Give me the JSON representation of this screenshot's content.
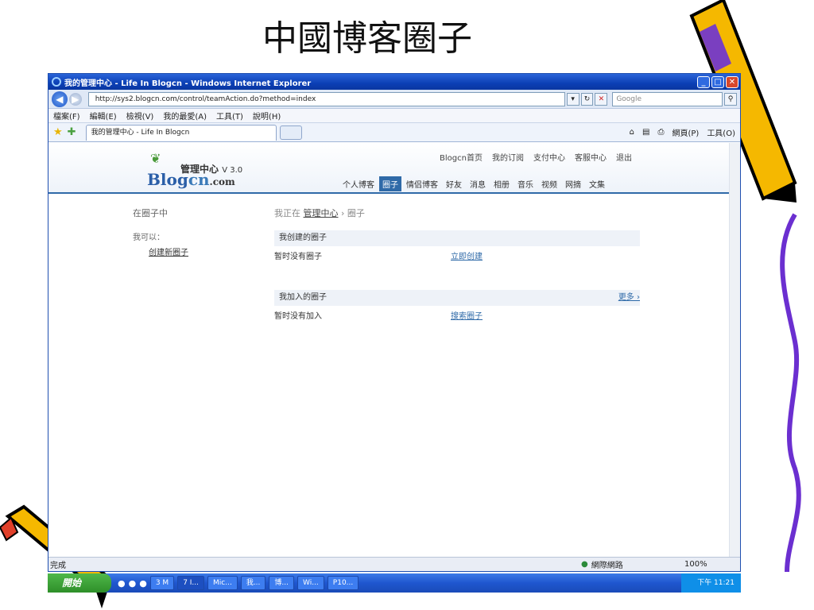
{
  "slide": {
    "title": "中國博客圈子"
  },
  "window": {
    "title": "我的管理中心 - Life In Blogcn - Windows Internet Explorer",
    "minimize": "_",
    "maximize": "□",
    "close": "✕"
  },
  "address": {
    "back": "◀",
    "forward": "▶",
    "url": "http://sys2.blogcn.com/control/teamAction.do?method=index",
    "search_placeholder": "Google"
  },
  "menu": [
    "檔案(F)",
    "編輯(E)",
    "檢視(V)",
    "我的最愛(A)",
    "工具(T)",
    "說明(H)"
  ],
  "tab": {
    "label": "我的管理中心 - Life In Blogcn"
  },
  "commandbar": {
    "page": "網頁(P)",
    "tools": "工具(O)"
  },
  "site": {
    "logo_sub": "管理中心",
    "logo_version": "V 3.0",
    "logo_b": "Blog",
    "logo_cn": "cn",
    "logo_com": ".com",
    "toplinks": [
      "Blogcn首页",
      "我的订阅",
      "支付中心",
      "客服中心",
      "退出"
    ],
    "nav": [
      "个人博客",
      "圈子",
      "情侣博客",
      "好友",
      "消息",
      "相册",
      "音乐",
      "视频",
      "网摘",
      "文集"
    ]
  },
  "sidebar": {
    "title": "在圈子中",
    "can": "我可以：",
    "create": "创建新圈子"
  },
  "breadcrumb": {
    "prefix": "我正在",
    "link": "管理中心",
    "sep": "›",
    "current": "圈子"
  },
  "created": {
    "header": "我创建的圈子",
    "empty": "暂时没有圈子",
    "action": "立即创建"
  },
  "joined": {
    "header": "我加入的圈子",
    "more": "更多 ›",
    "empty": "暂时没有加入",
    "action": "搜索圈子"
  },
  "status": {
    "left": "完成",
    "zone": "網際網路",
    "zoom": "100%"
  },
  "taskbar": {
    "start": "開始",
    "tasks": [
      "3 M",
      "7 I...",
      "Mic...",
      "我...",
      "博...",
      "Wi...",
      "P10..."
    ],
    "clock": "下午 11:21"
  }
}
